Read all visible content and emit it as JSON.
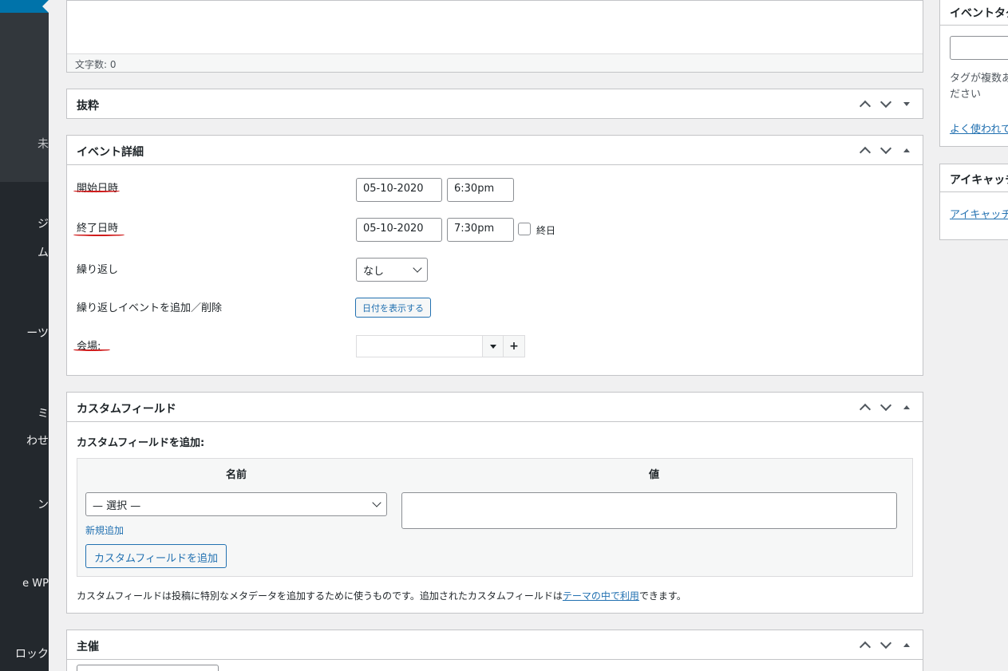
{
  "sidebar": {
    "items": [
      {
        "label": "未"
      },
      {
        "label": "ジ"
      },
      {
        "label": "ム"
      },
      {
        "label": "ーツ"
      },
      {
        "label": "ミ"
      },
      {
        "label": "わせ"
      },
      {
        "label": "ン"
      },
      {
        "label": "e WP"
      },
      {
        "label": "ロック"
      }
    ]
  },
  "editor": {
    "word_count": "文字数: 0"
  },
  "excerpt": {
    "title": "抜粋"
  },
  "event_details": {
    "title": "イベント詳細",
    "start_label": "開始日時",
    "start_date": "05-10-2020",
    "start_time": "6:30pm",
    "end_label": "終了日時",
    "end_date": "05-10-2020",
    "end_time": "7:30pm",
    "all_day_label": "終日",
    "repeat_label": "繰り返し",
    "repeat_value": "なし",
    "repeat_add_label": "繰り返しイベントを追加／削除",
    "show_dates_button": "日付を表示する",
    "venue_label": "会場:",
    "add_icon_text": "+"
  },
  "custom_fields": {
    "title": "カスタムフィールド",
    "add_heading": "カスタムフィールドを追加:",
    "col_name": "名前",
    "col_value": "値",
    "select_value": "— 選択 —",
    "new_link": "新規追加",
    "add_button": "カスタムフィールドを追加",
    "note_before": "カスタムフィールドは投稿に特別なメタデータを追加するために使うものです。追加されたカスタムフィールドは",
    "note_link": "テーマの中で利用",
    "note_after": "できます。"
  },
  "organizer": {
    "title": "主催"
  },
  "right_sidebar": {
    "tags_title": "イベントタグ",
    "tags_help_line1": "タグが複数あ",
    "tags_help_line2": "ださい",
    "tags_link": "よく使われて",
    "featured_title": "アイキャッチ",
    "featured_link": "アイキャッチ"
  }
}
